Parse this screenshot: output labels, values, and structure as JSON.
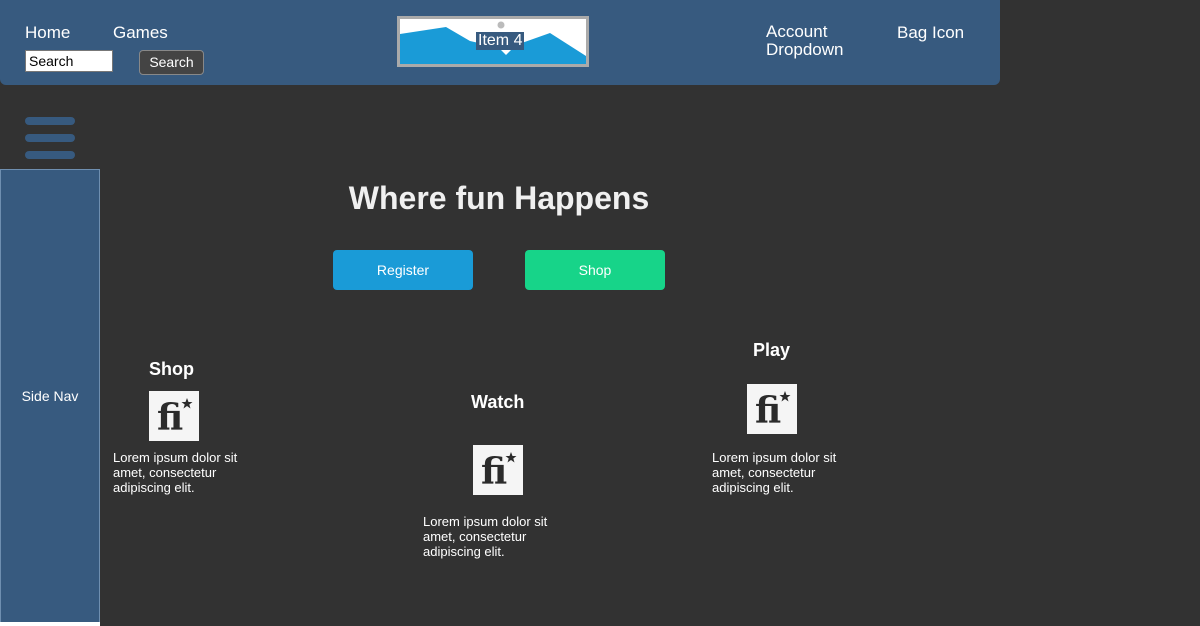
{
  "header": {
    "nav": {
      "home": "Home",
      "games": "Games"
    },
    "search": {
      "value": "Search",
      "button_label": "Search"
    },
    "logo": {
      "label": "Item 4"
    },
    "account_label": "Account Dropdown",
    "bag_label": "Bag Icon"
  },
  "side_nav": {
    "label": "Side Nav"
  },
  "hero": {
    "title": "Where fun Happens",
    "register_label": "Register",
    "shop_label": "Shop"
  },
  "features": [
    {
      "title": "Shop",
      "icon": "font-icon",
      "text": "Lorem ipsum dolor sit amet, consectetur adipiscing elit."
    },
    {
      "title": "Watch",
      "icon": "font-icon",
      "text": "Lorem ipsum dolor sit amet, consectetur adipiscing elit."
    },
    {
      "title": "Play",
      "icon": "font-icon",
      "text": "Lorem ipsum dolor sit amet, consectetur adipiscing elit."
    }
  ],
  "colors": {
    "background": "#323232",
    "header": "#375a7f",
    "register": "#1a9bd7",
    "shop": "#17d489"
  }
}
